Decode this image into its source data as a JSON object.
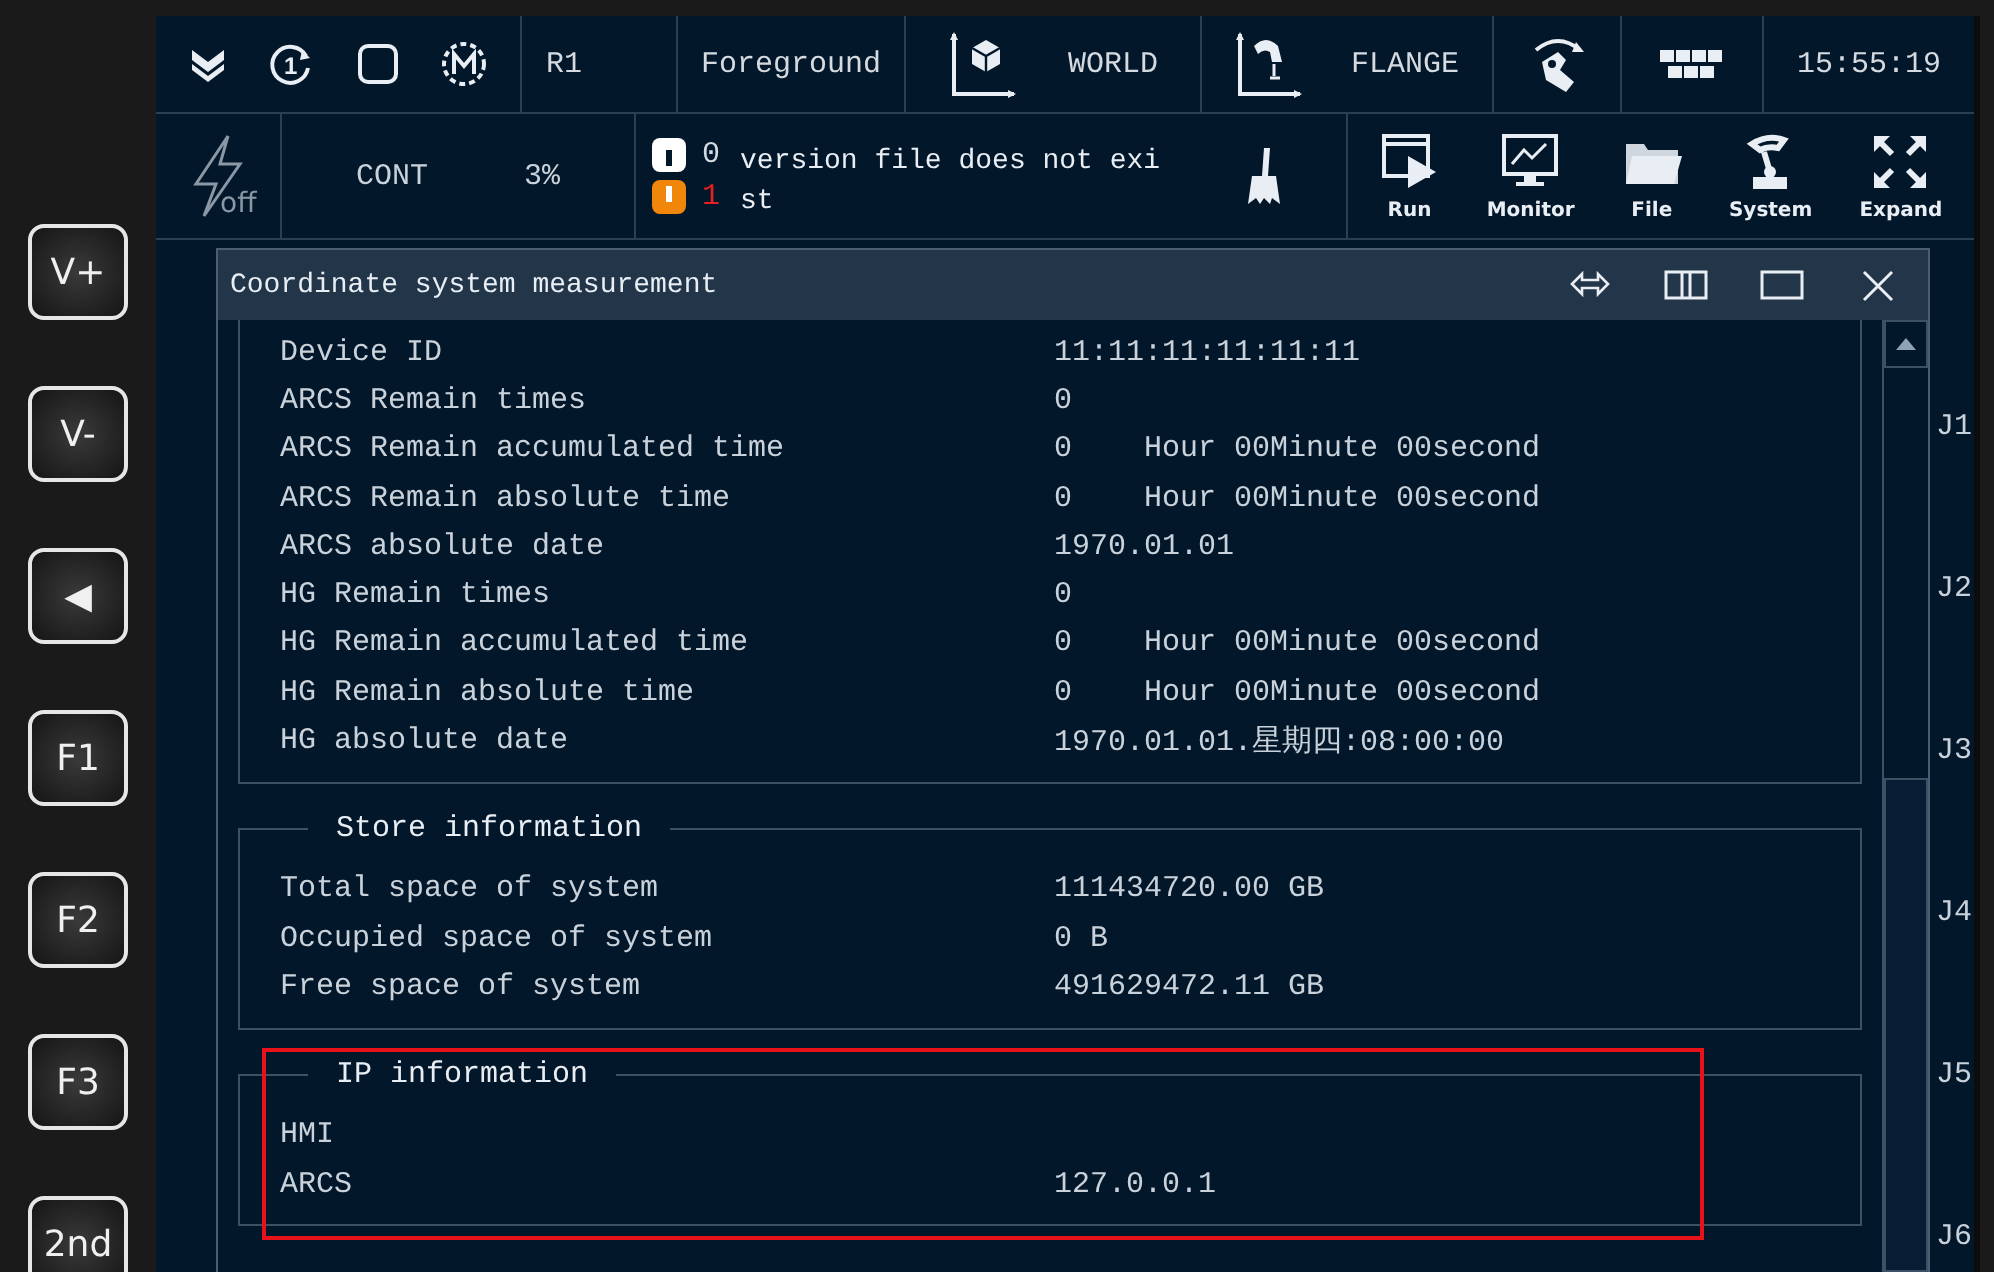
{
  "side_keys": [
    {
      "label": "V+"
    },
    {
      "label": "V-"
    },
    {
      "label": "◀"
    },
    {
      "label": "F1"
    },
    {
      "label": "F2"
    },
    {
      "label": "F3"
    },
    {
      "label": "2nd"
    }
  ],
  "top_bar": {
    "cycle_label": "1",
    "robot": "R1",
    "run_mode": "Foreground",
    "coordinate_system": "WORLD",
    "tool": "FLANGE",
    "time": "15:55:19"
  },
  "status_row": {
    "power_label": "off",
    "mode": "CONT",
    "speed": "3%",
    "info_count": "0",
    "warning_count": "1",
    "message_lines": [
      "version file does not exi",
      "st"
    ]
  },
  "toolbar": [
    {
      "kind": "run",
      "label": "Run"
    },
    {
      "kind": "monitor",
      "label": "Monitor"
    },
    {
      "kind": "file",
      "label": "File"
    },
    {
      "kind": "system",
      "label": "System"
    },
    {
      "kind": "expand",
      "label": "Expand"
    }
  ],
  "dialog": {
    "title": "Coordinate system measurement",
    "sections": [
      {
        "highlighted": false,
        "rows": [
          {
            "label": "Device ID",
            "value": "11:11:11:11:11:11"
          },
          {
            "label": "ARCS Remain times",
            "value": "0"
          },
          {
            "label": "ARCS Remain accumulated time",
            "value": "0    Hour 00Minute 00second"
          },
          {
            "label": "ARCS Remain absolute time",
            "value": "0    Hour 00Minute 00second"
          },
          {
            "label": "ARCS absolute date",
            "value": "1970.01.01"
          },
          {
            "label": "HG Remain times",
            "value": "0"
          },
          {
            "label": "HG Remain accumulated time",
            "value": "0    Hour 00Minute 00second"
          },
          {
            "label": "HG Remain absolute time",
            "value": "0    Hour 00Minute 00second"
          },
          {
            "label": "HG absolute date",
            "value": "1970.01.01.星期四:08:00:00"
          }
        ]
      },
      {
        "title": "Store information",
        "highlighted": false,
        "rows": [
          {
            "label": "Total space of system",
            "value": "111434720.00 GB"
          },
          {
            "label": "Occupied space of system",
            "value": "0 B"
          },
          {
            "label": "Free space of system",
            "value": "491629472.11 GB"
          }
        ]
      },
      {
        "title": "IP information",
        "highlighted": true,
        "rows": [
          {
            "label": "HMI"
          },
          {
            "label": "ARCS",
            "value": "127.0.0.1"
          }
        ]
      }
    ]
  },
  "joint_labels": [
    "J1",
    "J2",
    "J3",
    "J4",
    "J5",
    "J6"
  ]
}
